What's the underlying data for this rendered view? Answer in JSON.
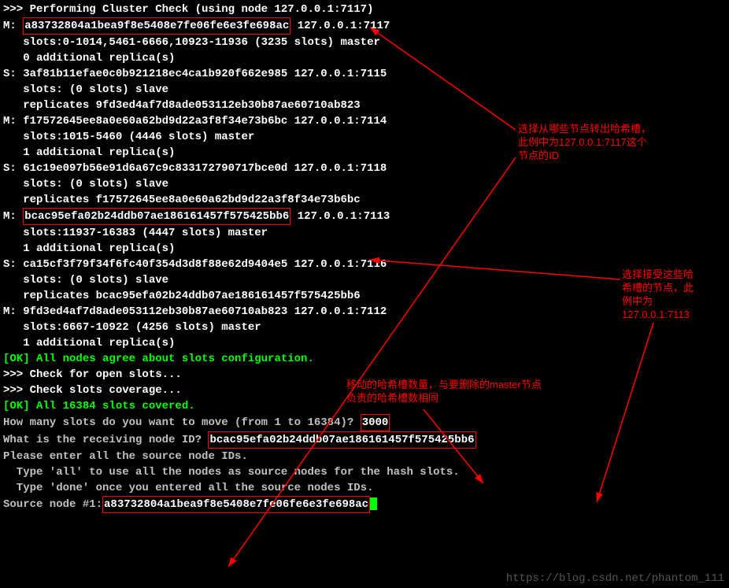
{
  "header": ">>> Performing Cluster Check (using node 127.0.0.1:7117)",
  "nodes": [
    {
      "role": "M:",
      "id": "a83732804a1bea9f8e5408e7fe06fe6e3fe698ac",
      "addr": "127.0.0.1:7117",
      "slots": "   slots:0-1014,5461-6666,10923-11936 (3235 slots) master",
      "replicas": "   0 additional replica(s)",
      "boxed": true
    },
    {
      "role": "S:",
      "id": "3af81b11efae0c0b921218ec4ca1b920f662e985",
      "addr": "127.0.0.1:7115",
      "slots": "   slots: (0 slots) slave",
      "replicas": "   replicates 9fd3ed4af7d8ade053112eb30b87ae60710ab823"
    },
    {
      "role": "M:",
      "id": "f17572645ee8a0e60a62bd9d22a3f8f34e73b6bc",
      "addr": "127.0.0.1:7114",
      "slots": "   slots:1015-5460 (4446 slots) master",
      "replicas": "   1 additional replica(s)"
    },
    {
      "role": "S:",
      "id": "61c19e097b56e91d6a67c9c833172790717bce0d",
      "addr": "127.0.0.1:7118",
      "slots": "   slots: (0 slots) slave",
      "replicas": "   replicates f17572645ee8a0e60a62bd9d22a3f8f34e73b6bc"
    },
    {
      "role": "M:",
      "id": "bcac95efa02b24ddb07ae186161457f575425bb6",
      "addr": "127.0.0.1:7113",
      "slots": "   slots:11937-16383 (4447 slots) master",
      "replicas": "   1 additional replica(s)",
      "boxed": true
    },
    {
      "role": "S:",
      "id": "ca15cf3f79f34f6fc40f354d3d8f88e62d9404e5",
      "addr": "127.0.0.1:7116",
      "slots": "   slots: (0 slots) slave",
      "replicas": "   replicates bcac95efa02b24ddb07ae186161457f575425bb6"
    },
    {
      "role": "M:",
      "id": "9fd3ed4af7d8ade053112eb30b87ae60710ab823",
      "addr": "127.0.0.1:7112",
      "slots": "   slots:6667-10922 (4256 slots) master",
      "replicas": "   1 additional replica(s)"
    }
  ],
  "ok1": "[OK] All nodes agree about slots configuration.",
  "check1": ">>> Check for open slots...",
  "check2": ">>> Check slots coverage...",
  "ok2": "[OK] All 16384 slots covered.",
  "q1": {
    "prompt": "How many slots do you want to move (from 1 to 16384)? ",
    "answer": "3000"
  },
  "q2": {
    "prompt": "What is the receiving node ID? ",
    "answer": "bcac95efa02b24ddb07ae186161457f575425bb6"
  },
  "q3a": "Please enter all the source node IDs.",
  "q3b": "  Type 'all' to use all the nodes as source nodes for the hash slots.",
  "q3c": "  Type 'done' once you entered all the source nodes IDs.",
  "q4": {
    "prompt": "Source node #1:",
    "answer": "a83732804a1bea9f8e5408e7fe06fe6e3fe698ac"
  },
  "watermark": "https://blog.csdn.net/phantom_111",
  "annotations": {
    "a1": "选择从哪些节点转出哈希槽，\n此例中为127.0.0.1:7117这个\n节点的ID",
    "a2": "选择接受这些哈\n希槽的节点，此\n例中为\n127.0.0.1:7113",
    "a3": "移动的哈希槽数量，与要删除的master节点\n负责的哈希槽数相同"
  }
}
